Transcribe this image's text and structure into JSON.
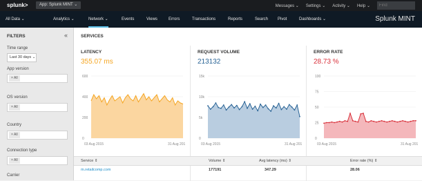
{
  "topbar": {
    "logo": "splunk>",
    "app": "App: Splunk MINT",
    "links": [
      "Messages",
      "Settings",
      "Activity",
      "Help"
    ],
    "find_placeholder": "Find"
  },
  "nav": {
    "items": [
      "All Data",
      "Analytics",
      "Network",
      "Events",
      "Views",
      "Errors",
      "Transactions",
      "Reports",
      "Search",
      "Pivot",
      "Dashboards"
    ],
    "active": "Network",
    "brand": "Splunk MINT"
  },
  "filters": {
    "title": "FILTERS",
    "time_range_label": "Time range",
    "time_range_value": "Last 30 days",
    "app_version_label": "App version",
    "os_version_label": "OS version",
    "country_label": "Country",
    "connection_type_label": "Connection type",
    "carrier_label": "Carrier",
    "pill": "× All"
  },
  "services": {
    "title": "SERVICES",
    "latency": {
      "title": "LATENCY",
      "value": "355.07 ms",
      "color": "#f5a623"
    },
    "volume": {
      "title": "REQUEST VOLUME",
      "value": "213132",
      "color": "#2a6496"
    },
    "error_rate": {
      "title": "ERROR RATE",
      "value": "28.73 %",
      "color": "#d9323c"
    }
  },
  "table": {
    "headers": [
      "Service",
      "Volume",
      "Avg latency (ms)",
      "Error rate (%)"
    ],
    "rows": [
      [
        "m.retailcomp.com",
        "177191",
        "347.29",
        "28.06"
      ]
    ]
  },
  "chart_data": [
    {
      "type": "area",
      "title": "LATENCY",
      "ylim": [
        0,
        600
      ],
      "yticks": [
        "600",
        "400",
        "200",
        "0"
      ],
      "x_labels": [
        "03 Aug 2015",
        "31 Aug 201"
      ],
      "values": [
        360,
        420,
        380,
        410,
        350,
        390,
        320,
        370,
        410,
        360,
        380,
        400,
        340,
        390,
        420,
        380,
        360,
        410,
        350,
        390,
        430,
        370,
        400,
        360,
        390,
        420,
        350,
        380,
        410,
        370,
        350,
        390,
        320,
        360,
        340,
        330
      ]
    },
    {
      "type": "area",
      "title": "REQUEST VOLUME",
      "ylim": [
        0,
        15000
      ],
      "yticks": [
        "15k",
        "10k",
        "5k",
        "0"
      ],
      "x_labels": [
        "03 Aug 2015",
        "31 Aug 201"
      ],
      "values": [
        7800,
        7000,
        7600,
        8500,
        7400,
        7200,
        8000,
        6800,
        7500,
        8100,
        7300,
        7900,
        6900,
        7600,
        8800,
        7200,
        8300,
        7000,
        7700,
        6600,
        8200,
        7400,
        8000,
        7100,
        6500,
        7800,
        7300,
        8400,
        6900,
        7600,
        7000,
        8100,
        7500,
        6800,
        8000,
        5200
      ]
    },
    {
      "type": "area",
      "title": "ERROR RATE",
      "ylim": [
        0,
        100
      ],
      "yticks": [
        "100",
        "75",
        "50",
        "25",
        "0"
      ],
      "x_labels": [
        "03 Aug 2015",
        "31 Aug 201"
      ],
      "values": [
        24,
        25,
        25,
        26,
        25,
        26,
        27,
        26,
        28,
        27,
        40,
        28,
        27,
        26,
        39,
        40,
        27,
        26,
        28,
        27,
        26,
        27,
        28,
        27,
        26,
        27,
        28,
        27,
        26,
        27,
        28,
        27,
        26,
        27,
        28,
        28
      ]
    }
  ]
}
